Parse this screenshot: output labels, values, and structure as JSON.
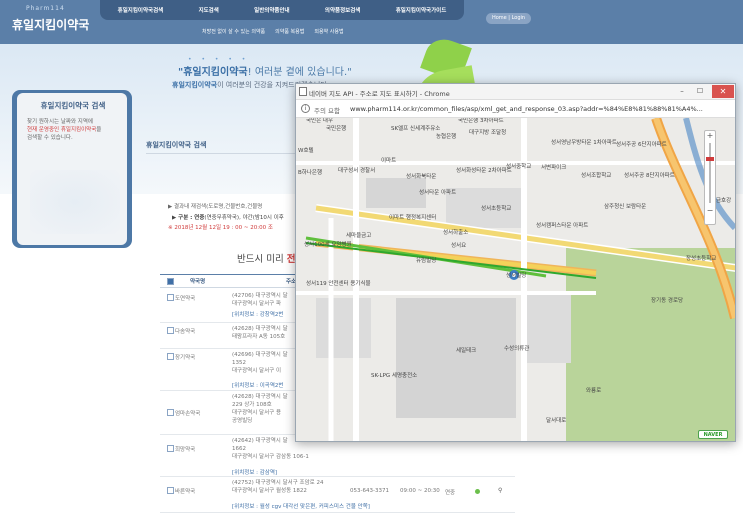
{
  "site": {
    "logo_small": "Pharm114",
    "logo": "휴일지킴이약국",
    "nav": [
      "휴일지킴이약국검색",
      "지도검색",
      "일반의약품안내",
      "의약품정보검색",
      "휴일지킴이약국가이드"
    ],
    "subnav": [
      "처방전 없이 살 수 있는 의약품",
      "의약품 복용법",
      "외용약 사용법"
    ],
    "home_login": "Home | Login"
  },
  "hero": {
    "line1_brand": "\"휴일지킴이약국",
    "line1_rest": "! 여러분 곁에 있습니다.\"",
    "line2_brand": "휴일지킴이약국",
    "line2_rest": "이 여러분의 건강을 지켜드리겠습니다."
  },
  "sidebar": {
    "title": "휴일지킴이약국 검색",
    "text1": "찾기 원하시는 날짜와 지역에",
    "text2_red": "현재 운영중인 휴일지킴이약국",
    "text2_rest": "을",
    "text3": "검색할 수 있습니다."
  },
  "main": {
    "section_title": "휴일지킴이약국 검색",
    "info1": "▶ 결과내 재검색(도로명,건물번호,건물명",
    "info2_bold": "▶ 구분 : 연중",
    "info2_rest": "(연중무휴약국), 야간(밤10시 이후",
    "info3": "※ 2018년 12월 12일 19 : 00 ~ 20:00 조",
    "banner_prefix": "반드시 미리 ",
    "banner_red": "전화",
    "table_headers": {
      "name": "약국명",
      "address": "주소"
    }
  },
  "rows": [
    {
      "name": "도연약국",
      "addr": [
        "(42706) 대구광역시 달",
        "대구광역시 달서구 파"
      ],
      "loc": "[위치정보 : 강창역2번"
    },
    {
      "name": "다솜약국",
      "addr": [
        "(42628) 대구광역시 달",
        "태왕프라자 A동 105호"
      ],
      "loc": ""
    },
    {
      "name": "장기약국",
      "addr": [
        "(42696) 대구광역시 달",
        "1352",
        "대구광역시 달서구 이"
      ],
      "loc": "[위치정보 : 이곡역2번"
    },
    {
      "name": "엄마손약국",
      "addr": [
        "(42628) 대구광역시 달",
        "229 상가 108호",
        "대구광역시 달서구 용",
        "공영빌딩"
      ],
      "loc": ""
    },
    {
      "name": "희망약국",
      "addr": [
        "(42642) 대구광역시 달",
        "1662",
        "대구광역시 달서구 감삼동 106-1"
      ],
      "loc": "[위치정보 : 감삼역]"
    },
    {
      "name": "바른약국",
      "addr": [
        "(42752) 대구광역시 달서구 조암로 24",
        "대구광역시 달서구 월성동 1822"
      ],
      "phone": "053-643-3371",
      "hours": "09:00 ~ 20:30",
      "days": "연중",
      "loc": "[위치정보 : 월성 cgv 대각선 맞은편, 커피스미스 건물 안쪽]"
    }
  ],
  "popup": {
    "title": "네이버 지도 API - 주소로 지도 표시하기 - Chrome",
    "warn": "주의 요함",
    "url": "www.pharm114.or.kr/common_files/asp/xml_get_and_response_03.asp?addr=%84%E8%81%88%81%A4%...",
    "naver": "NAVER",
    "places": [
      "국민은행",
      "SK엘프 신세계주유소",
      "농협은행",
      "대구지방 조달청",
      "국민은행 3차아파트",
      "성서영남우방타운 1차아파트",
      "성서주공 6단지아파트",
      "W호텔",
      "이마트",
      "B하나은행",
      "대구성서 경찰서",
      "성서화북타운",
      "성서화성타운 2차아파트",
      "성서중학교",
      "서변파이크",
      "성서조합학교",
      "성서주공 8단지아파트",
      "성서타운 아파트",
      "성서초등학교",
      "삼주청신 보람타운",
      "이마트 행정복지센터",
      "세마을금고",
      "성서하출소",
      "성서캠퍼스타운 아파트",
      "장성초등학교",
      "성서100세 요양병원",
      "유림빌딩",
      "성서119 안전센터 용기식물",
      "성서빌딩",
      "장기동 경로당",
      "세일테크",
      "수성의류관",
      "SK-LPG 세명충전소",
      "금호강",
      "와룡로",
      "달서대로",
      "성서요",
      "국민은 대우"
    ]
  }
}
